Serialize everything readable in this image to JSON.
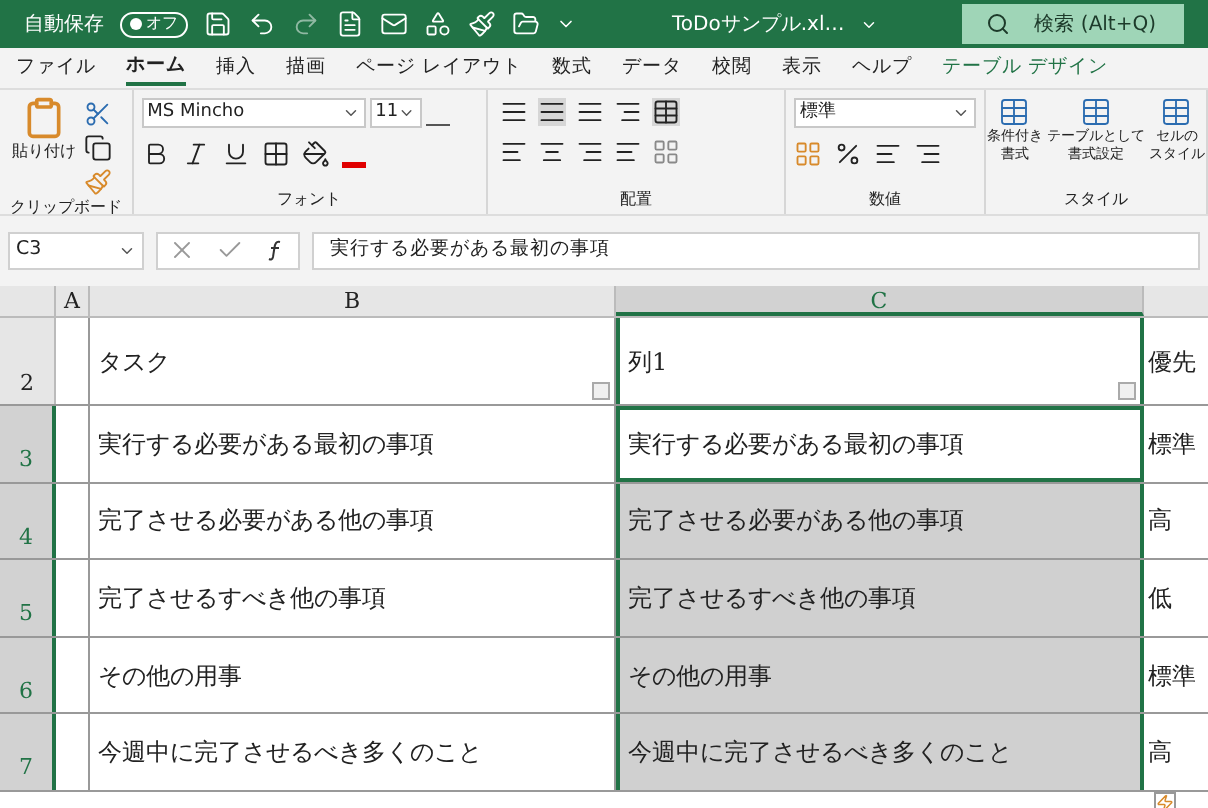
{
  "title_bar": {
    "autosave_label": "自動保存",
    "autosave_toggle": {
      "label": "オフ",
      "on": false
    },
    "file_name": "ToDoサンプル.xl…",
    "search": {
      "placeholder": "検索 (Alt+Q)"
    }
  },
  "tabs": [
    {
      "label": "ファイル",
      "selected": false,
      "kind": "normal"
    },
    {
      "label": "ホーム",
      "selected": true,
      "kind": "normal"
    },
    {
      "label": "挿入",
      "selected": false,
      "kind": "normal"
    },
    {
      "label": "描画",
      "selected": false,
      "kind": "normal"
    },
    {
      "label": "ページ レイアウト",
      "selected": false,
      "kind": "normal"
    },
    {
      "label": "数式",
      "selected": false,
      "kind": "normal"
    },
    {
      "label": "データ",
      "selected": false,
      "kind": "normal"
    },
    {
      "label": "校閲",
      "selected": false,
      "kind": "normal"
    },
    {
      "label": "表示",
      "selected": false,
      "kind": "normal"
    },
    {
      "label": "ヘルプ",
      "selected": false,
      "kind": "normal"
    },
    {
      "label": "テーブル デザイン",
      "selected": false,
      "kind": "contextual"
    }
  ],
  "ribbon": {
    "paste_label": "貼り付け",
    "font_name": "MS Mincho",
    "font_size": "11",
    "number_format": "標準",
    "styles": [
      {
        "line1": "条件付き",
        "line2": "書式"
      },
      {
        "line1": "テーブルとして",
        "line2": "書式設定"
      },
      {
        "line1": "セルの",
        "line2": "スタイル"
      }
    ],
    "groups": [
      "クリップボード",
      "フォント",
      "配置",
      "数値",
      "スタイル"
    ]
  },
  "formula_bar": {
    "name_box": "C3",
    "formula": "実行する必要がある最初の事項"
  },
  "columns": [
    {
      "label": "A",
      "selected": false
    },
    {
      "label": "B",
      "selected": false
    },
    {
      "label": "C",
      "selected": true
    }
  ],
  "rows": [
    {
      "number": "2",
      "selected": false,
      "kind": "header",
      "task": "タスク",
      "col1": "列1",
      "col1_active": false,
      "col1_selected": false,
      "priority": "優先"
    },
    {
      "number": "3",
      "selected": true,
      "kind": "data",
      "task": "実行する必要がある最初の事項",
      "col1": "実行する必要がある最初の事項",
      "col1_active": true,
      "col1_selected": false,
      "priority": "標準"
    },
    {
      "number": "4",
      "selected": true,
      "kind": "data",
      "task": "完了させる必要がある他の事項",
      "col1": "完了させる必要がある他の事項",
      "col1_active": false,
      "col1_selected": true,
      "priority": "高"
    },
    {
      "number": "5",
      "selected": true,
      "kind": "data",
      "task": "完了させるすべき他の事項",
      "col1": "完了させるすべき他の事項",
      "col1_active": false,
      "col1_selected": true,
      "priority": "低"
    },
    {
      "number": "6",
      "selected": true,
      "kind": "data",
      "task": "その他の用事",
      "col1": "その他の用事",
      "col1_active": false,
      "col1_selected": true,
      "priority": "標準"
    },
    {
      "number": "7",
      "selected": true,
      "kind": "data",
      "task": "今週中に完了させるべき多くのこと",
      "col1": "今週中に完了させるべき多くのこと",
      "col1_active": false,
      "col1_selected": true,
      "priority": "高"
    }
  ]
}
